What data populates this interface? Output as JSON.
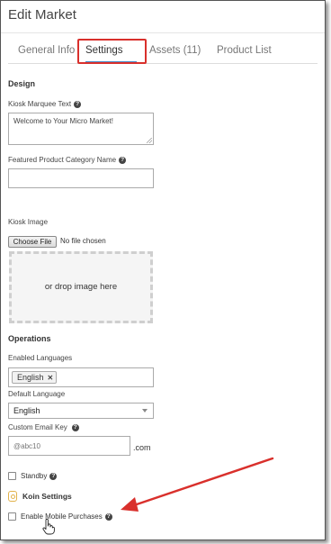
{
  "window": {
    "title": "Edit Market"
  },
  "tabs": [
    {
      "label": "General Info"
    },
    {
      "label": "Settings"
    },
    {
      "label": "Assets (11)"
    },
    {
      "label": "Product List"
    }
  ],
  "active_tab": "Settings",
  "design": {
    "section_title": "Design",
    "kiosk_marquee_label": "Kiosk Marquee Text",
    "kiosk_marquee_value": "Welcome to Your Micro Market!",
    "featured_category_label": "Featured Product Category Name",
    "featured_category_value": "",
    "kiosk_image_label": "Kiosk Image",
    "choose_file_label": "Choose File",
    "file_status": "No file chosen",
    "dropzone_text": "or drop image here"
  },
  "operations": {
    "section_title": "Operations",
    "enabled_languages_label": "Enabled Languages",
    "enabled_languages": [
      "English"
    ],
    "default_language_label": "Default Language",
    "default_language_value": "English",
    "custom_email_key_label": "Custom Email Key",
    "custom_email_key_placeholder": "@abc10",
    "email_suffix": ".com",
    "standby_label": "Standby",
    "standby_checked": false
  },
  "koin": {
    "section_title": "Koin Settings",
    "enable_mobile_label": "Enable Mobile Purchases",
    "enable_mobile_checked": false
  },
  "colors": {
    "annotation_red": "#d9302c",
    "tab_underline": "#4a8ec9",
    "koin_gold": "#e2b24a"
  },
  "icons": {
    "help": "question-circle-icon",
    "koin": "koin-icon",
    "tag_remove": "close-icon",
    "select_caret": "caret-down-icon",
    "cursor": "hand-pointer-icon"
  }
}
